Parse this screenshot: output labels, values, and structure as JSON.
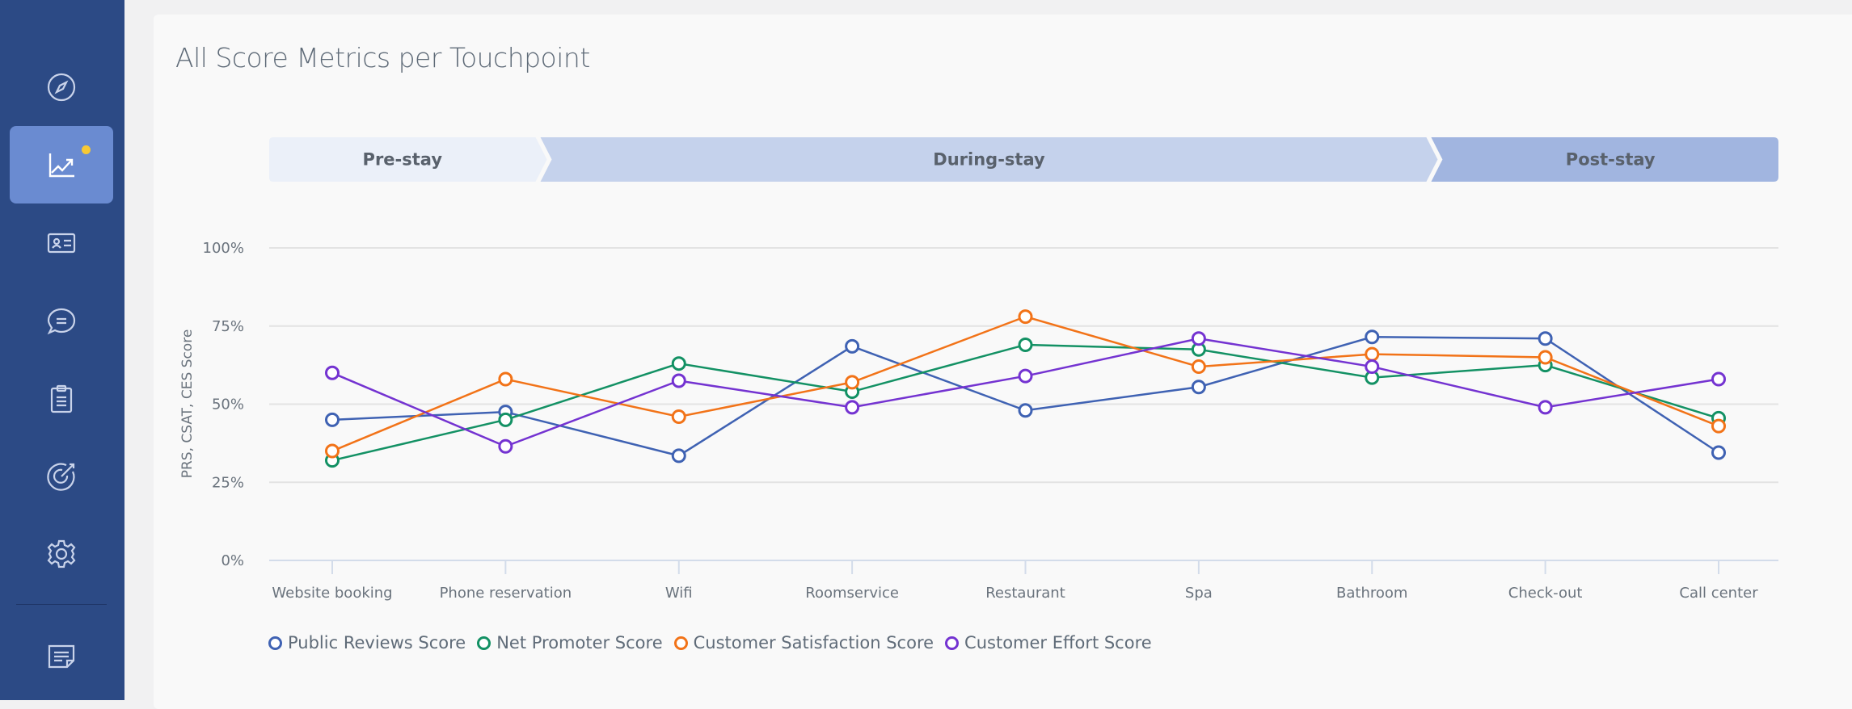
{
  "sidebar": {
    "items": [
      {
        "name": "explore",
        "icon": "compass-icon",
        "active": false
      },
      {
        "name": "analytics",
        "icon": "chart-trend-icon",
        "active": true,
        "badge": true
      },
      {
        "name": "contacts",
        "icon": "id-card-icon",
        "active": false
      },
      {
        "name": "messages",
        "icon": "chat-bubble-icon",
        "active": false
      },
      {
        "name": "surveys",
        "icon": "clipboard-icon",
        "active": false
      },
      {
        "name": "goals",
        "icon": "target-icon",
        "active": false
      },
      {
        "name": "settings",
        "icon": "gear-icon",
        "active": false
      },
      {
        "name": "notes",
        "icon": "note-icon",
        "active": false
      }
    ],
    "badge_color": "#f7c935"
  },
  "card": {
    "title": "All Score Metrics per Touchpoint"
  },
  "phases": [
    {
      "label": "Pre-stay",
      "color": "#ebf0f9",
      "from": "Website booking",
      "to": "Phone reservation"
    },
    {
      "label": "During-stay",
      "color": "#c5d2ec",
      "from": "Wifi",
      "to": "Bathroom"
    },
    {
      "label": "Post-stay",
      "color": "#a1b5e0",
      "from": "Check-out",
      "to": "Call center"
    }
  ],
  "chart_data": {
    "type": "line",
    "title": "All Score Metrics per Touchpoint",
    "xlabel": "",
    "ylabel": "PRS, CSAT, CES Score",
    "ylim": [
      0,
      100
    ],
    "yticks": [
      "0%",
      "25%",
      "50%",
      "75%",
      "100%"
    ],
    "ytick_values": [
      0,
      25,
      50,
      75,
      100
    ],
    "grid": true,
    "legend_position": "bottom-left",
    "categories": [
      "Website booking",
      "Phone reservation",
      "Wifi",
      "Roomservice",
      "Restaurant",
      "Spa",
      "Bathroom",
      "Check-out",
      "Call center"
    ],
    "series": [
      {
        "name": "Public Reviews Score",
        "color": "#3f62b3",
        "values": [
          45,
          47.5,
          33.5,
          68.5,
          48,
          55.5,
          71.5,
          71,
          34.5
        ]
      },
      {
        "name": "Net Promoter Score",
        "color": "#139164",
        "values": [
          32,
          45,
          63,
          54,
          69,
          67.5,
          58.5,
          62.5,
          45.5
        ]
      },
      {
        "name": "Customer Satisfaction Score",
        "color": "#f27318",
        "values": [
          35,
          58,
          46,
          57,
          78,
          62,
          66,
          65,
          43
        ]
      },
      {
        "name": "Customer Effort Score",
        "color": "#7433d1",
        "values": [
          60,
          36.5,
          57.5,
          49,
          59,
          71,
          62,
          49,
          58
        ]
      }
    ]
  }
}
